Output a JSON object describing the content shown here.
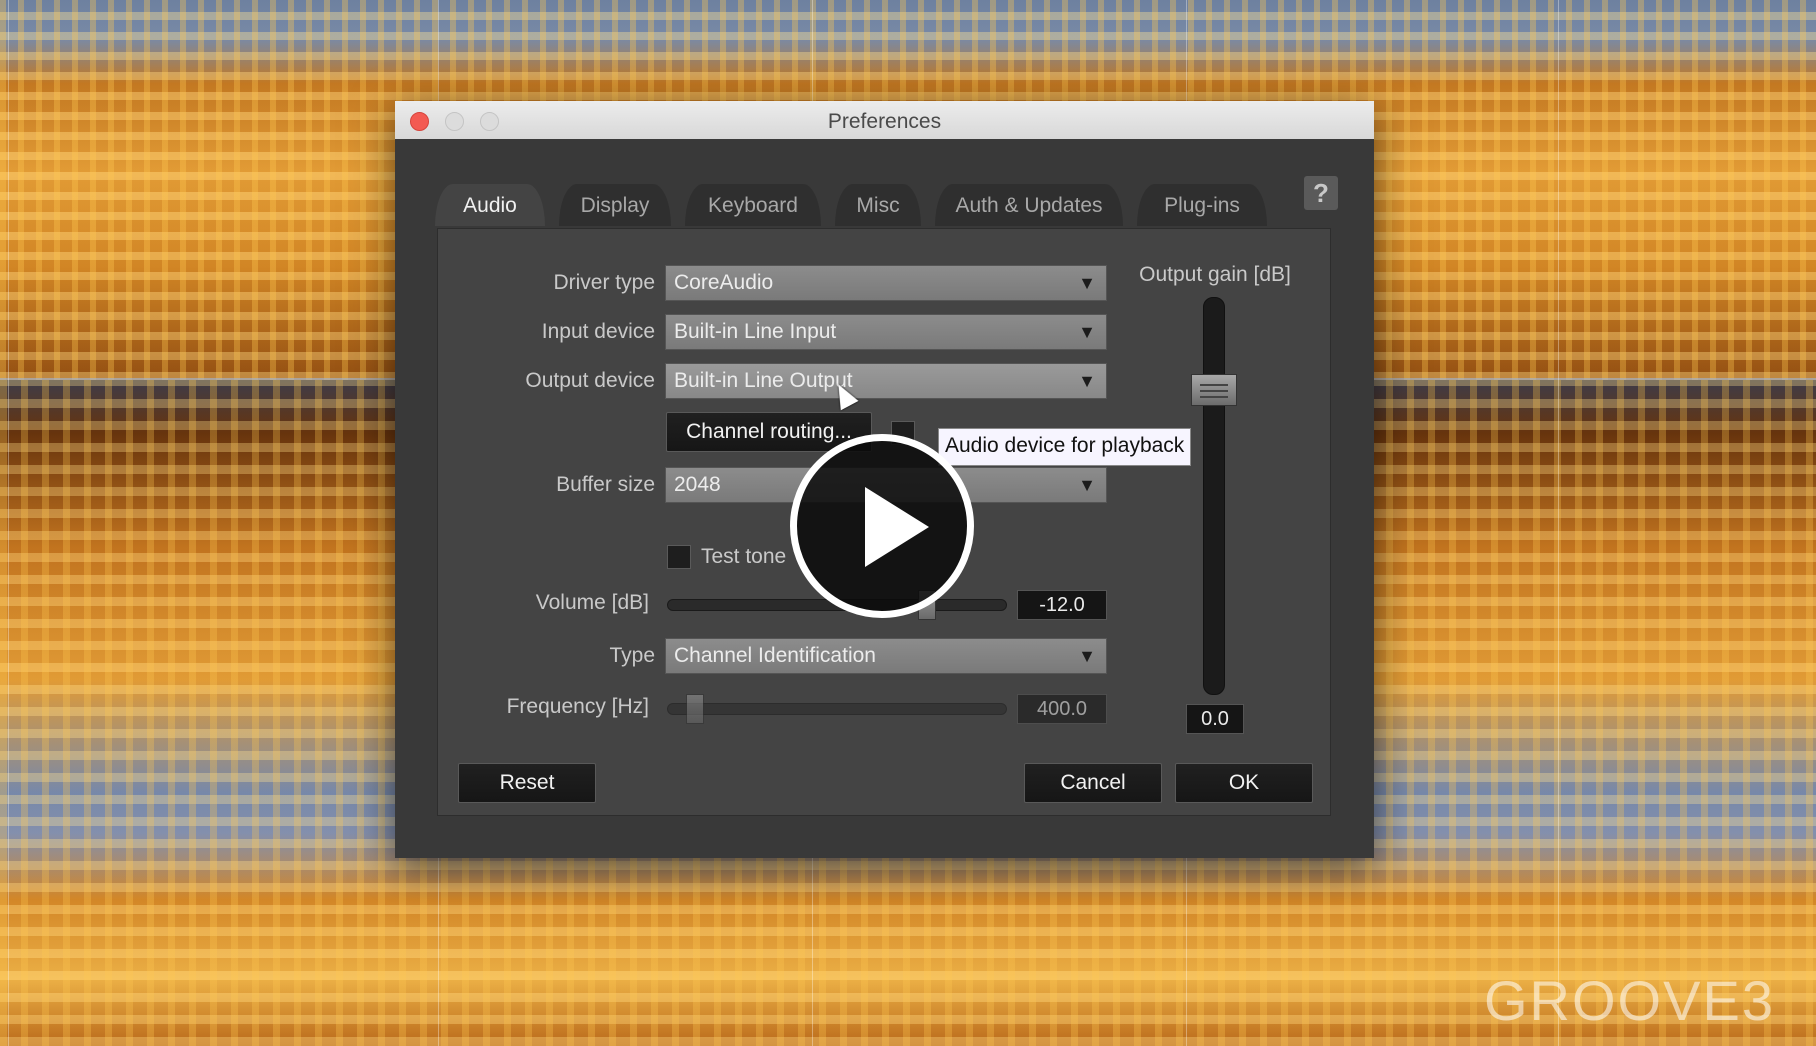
{
  "window": {
    "title": "Preferences"
  },
  "tabs": [
    {
      "label": "Audio",
      "active": true
    },
    {
      "label": "Display",
      "active": false
    },
    {
      "label": "Keyboard",
      "active": false
    },
    {
      "label": "Misc",
      "active": false
    },
    {
      "label": "Auth & Updates",
      "active": false
    },
    {
      "label": "Plug-ins",
      "active": false
    }
  ],
  "help": {
    "label": "?"
  },
  "audio": {
    "driver_type": {
      "label": "Driver type",
      "value": "CoreAudio"
    },
    "input_device": {
      "label": "Input device",
      "value": "Built-in Line Input"
    },
    "output_device": {
      "label": "Output device",
      "value": "Built-in Line Output"
    },
    "channel_routing": {
      "label": "Channel routing..."
    },
    "buffer_size": {
      "label": "Buffer size",
      "value": "2048"
    },
    "test_tone": {
      "label": "Test tone",
      "checked": false
    },
    "volume": {
      "label": "Volume [dB]",
      "value": "-12.0",
      "fraction": 0.78
    },
    "type": {
      "label": "Type",
      "value": "Channel Identification"
    },
    "frequency": {
      "label": "Frequency [Hz]",
      "value": "400.0",
      "fraction": 0.06
    },
    "output_gain": {
      "label": "Output gain [dB]",
      "value": "0.0",
      "fraction": 0.79
    }
  },
  "tooltip": {
    "text": "Audio device for playback"
  },
  "buttons": {
    "reset": "Reset",
    "cancel": "Cancel",
    "ok": "OK"
  },
  "watermark": {
    "text": "GROOVE3"
  },
  "arrow_glyph": "▼"
}
